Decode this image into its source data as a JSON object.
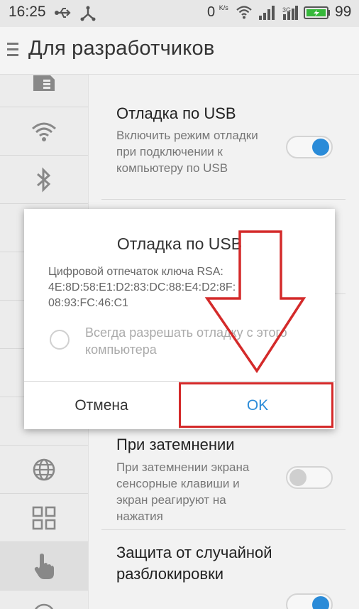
{
  "status_bar": {
    "time": "16:25",
    "data_rate": "0",
    "data_rate_unit": "K/s",
    "battery_level": "99",
    "icons": [
      "usb-icon",
      "usb-debug-icon",
      "wifi-icon",
      "signal-icon",
      "3g-icon",
      "battery-icon"
    ]
  },
  "header": {
    "title": "Для разработчиков"
  },
  "sidebar": {
    "items": [
      {
        "icon": "sim-icon"
      },
      {
        "icon": "wifi-icon"
      },
      {
        "icon": "bluetooth-icon"
      },
      {
        "icon": "globe-icon"
      },
      {
        "icon": "apps-grid-icon"
      },
      {
        "icon": "hand-touch-icon"
      }
    ]
  },
  "settings": {
    "usb_debug": {
      "title": "Отладка по USB",
      "description": "Включить режим отладки при подключении к компьютеру по USB",
      "enabled": true
    },
    "dimming": {
      "title": "При затемнении",
      "description": "При затемнении экрана сенсорные клавиши и экран реагируют на нажатия",
      "enabled": false
    },
    "unlock_protection": {
      "title": "Защита от случайной разблокировки"
    }
  },
  "dialog": {
    "title": "Отладка по USB",
    "message": "Цифровой отпечаток ключа RSA: 4E:8D:58:E1:D2:83:DC:88:E4:D2:8F: 08:93:FC:46:C1",
    "checkbox_label": "Всегда разрешать отладку с этого компьютера",
    "checkbox_checked": false,
    "cancel_label": "Отмена",
    "ok_label": "OK"
  },
  "colors": {
    "accent": "#2a8bd8",
    "annotation": "#d42a2a"
  }
}
